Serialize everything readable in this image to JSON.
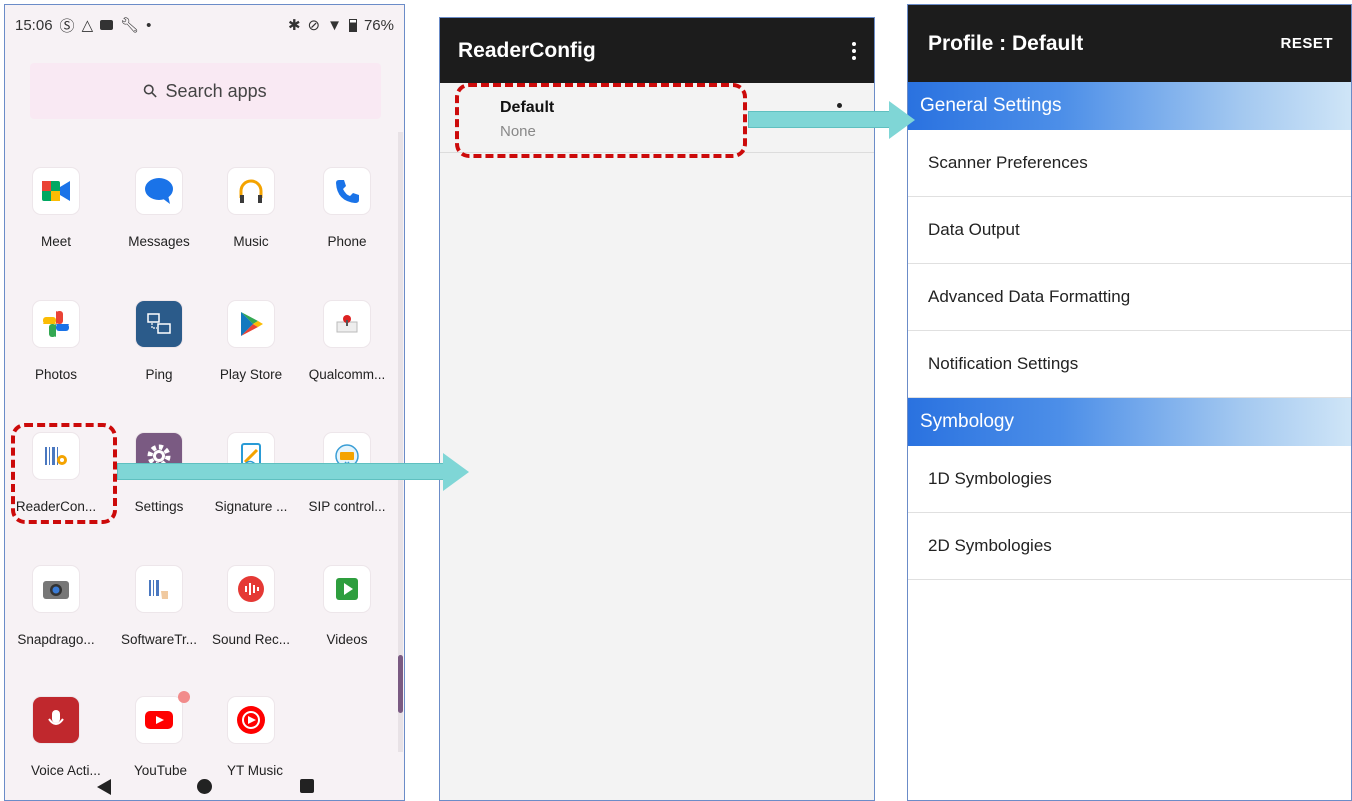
{
  "statusbar": {
    "time": "15:06",
    "left_icons": [
      "calendar-icon",
      "drive-icon",
      "youtube-icon",
      "wrench-icon",
      "dot-icon"
    ],
    "right_icons": [
      "bluetooth-icon",
      "mute-icon",
      "wifi-icon",
      "battery-icon"
    ],
    "battery": "76%"
  },
  "launcher": {
    "search_placeholder": "Search apps",
    "apps": [
      {
        "label": "Meet",
        "icon": "meet-icon",
        "color": "#00a862"
      },
      {
        "label": "Messages",
        "icon": "messages-icon",
        "color": "#1a73e8"
      },
      {
        "label": "Music",
        "icon": "headphones-icon",
        "color": "#f4a300"
      },
      {
        "label": "Phone",
        "icon": "phone-icon",
        "color": "#1a73e8"
      },
      {
        "label": "Photos",
        "icon": "photos-icon",
        "color": "#ea4335"
      },
      {
        "label": "Ping",
        "icon": "ping-icon",
        "color": "#2b5b8a"
      },
      {
        "label": "Play Store",
        "icon": "play-store-icon",
        "color": "#01875f"
      },
      {
        "label": "Qualcomm...",
        "icon": "qualcomm-icon",
        "color": "#d22"
      },
      {
        "label": "ReaderCon...",
        "icon": "reader-config-icon",
        "color": "#4a78c0"
      },
      {
        "label": "Settings",
        "icon": "gear-icon",
        "color": "#7a5a82"
      },
      {
        "label": "Signature ...",
        "icon": "signature-icon",
        "color": "#2a9bd6"
      },
      {
        "label": "SIP control...",
        "icon": "keyboard-icon",
        "color": "#3a9ed6"
      },
      {
        "label": "Snapdrago...",
        "icon": "camera-icon",
        "color": "#555555"
      },
      {
        "label": "SoftwareTr...",
        "icon": "software-trigger-icon",
        "color": "#4a78c0"
      },
      {
        "label": "Sound Rec...",
        "icon": "sound-recorder-icon",
        "color": "#e53935"
      },
      {
        "label": "Videos",
        "icon": "videos-icon",
        "color": "#2e9e3e"
      },
      {
        "label": "Voice Acti...",
        "icon": "voice-action-icon",
        "color": "#c0282d"
      },
      {
        "label": "YouTube",
        "icon": "youtube-icon",
        "color": "#ff0000"
      },
      {
        "label": "YT Music",
        "icon": "yt-music-icon",
        "color": "#ff0000"
      }
    ]
  },
  "readerconfig": {
    "title": "ReaderConfig",
    "profile_name": "Default",
    "profile_sub": "None"
  },
  "profile": {
    "title": "Profile : Default",
    "reset": "RESET",
    "section_general": "General Settings",
    "general_items": [
      "Scanner Preferences",
      "Data Output",
      "Advanced Data Formatting",
      "Notification Settings"
    ],
    "section_symbology": "Symbology",
    "symbology_items": [
      "1D Symbologies",
      "2D Symbologies"
    ]
  },
  "colors": {
    "highlight_dash": "#cc0a0a",
    "arrow": "#7fd6d6",
    "appbar": "#1c1c1c",
    "section_blue": "#2a72e0"
  }
}
